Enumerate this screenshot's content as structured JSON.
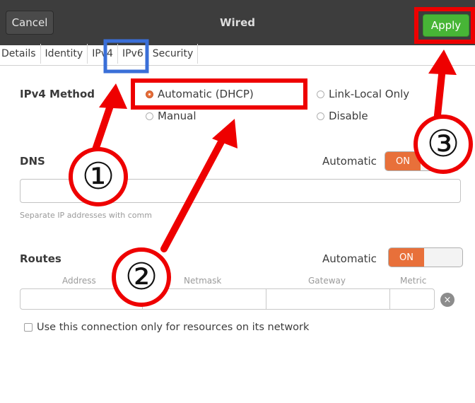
{
  "header": {
    "cancel": "Cancel",
    "title": "Wired",
    "apply": "Apply"
  },
  "tabs": [
    "Details",
    "Identity",
    "IPv4",
    "IPv6",
    "Security"
  ],
  "ipv4": {
    "method_label": "IPv4 Method",
    "options": {
      "automatic": "Automatic (DHCP)",
      "manual": "Manual",
      "link_local": "Link-Local Only",
      "disable": "Disable"
    },
    "selected": "Automatic (DHCP)"
  },
  "dns": {
    "label": "DNS",
    "automatic_label": "Automatic",
    "toggle": "ON",
    "hint": "Separate IP addresses with comm"
  },
  "routes": {
    "label": "Routes",
    "automatic_label": "Automatic",
    "toggle": "ON",
    "columns": [
      "Address",
      "Netmask",
      "Gateway",
      "Metric"
    ]
  },
  "only_local_label": "Use this connection only for resources on its network",
  "annotations": {
    "step1": "①",
    "step2": "②",
    "step3": "③"
  },
  "colors": {
    "highlight_red": "#ee0000",
    "highlight_blue": "#3a6fd8",
    "apply_green": "#47b536",
    "toggle_orange": "#e8703a"
  }
}
